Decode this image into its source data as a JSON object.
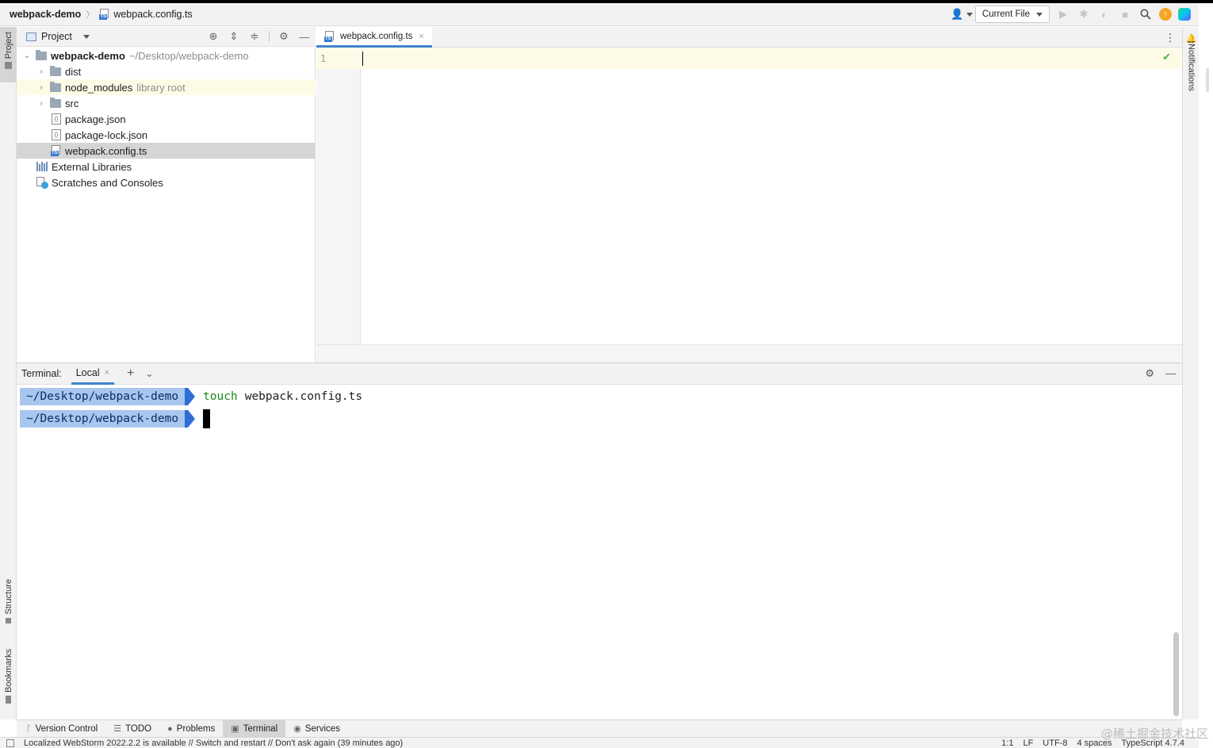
{
  "titlebar": {
    "project": "webpack-demo",
    "file": "webpack.config.ts",
    "run_config": "Current File"
  },
  "left_strip": {
    "project_tab": "Project",
    "structure_tab": "Structure",
    "bookmarks_tab": "Bookmarks"
  },
  "right_strip": {
    "notifications_tab": "Notifications"
  },
  "project_panel": {
    "title": "Project",
    "tree": [
      {
        "label": "webpack-demo",
        "hint": "~/Desktop/webpack-demo"
      },
      {
        "label": "dist",
        "hint": ""
      },
      {
        "label": "node_modules",
        "hint": "library root"
      },
      {
        "label": "src",
        "hint": ""
      },
      {
        "label": "package.json",
        "hint": ""
      },
      {
        "label": "package-lock.json",
        "hint": ""
      },
      {
        "label": "webpack.config.ts",
        "hint": ""
      },
      {
        "label": "External Libraries",
        "hint": ""
      },
      {
        "label": "Scratches and Consoles",
        "hint": ""
      }
    ]
  },
  "editor": {
    "tab_label": "webpack.config.ts",
    "line_number": "1"
  },
  "terminal": {
    "label": "Terminal:",
    "tab": "Local",
    "lines": [
      {
        "prompt": "~/Desktop/webpack-demo",
        "command": "touch",
        "args": "webpack.config.ts"
      },
      {
        "prompt": "~/Desktop/webpack-demo",
        "command": "",
        "args": ""
      }
    ]
  },
  "bottom_tabs": [
    "Version Control",
    "TODO",
    "Problems",
    "Terminal",
    "Services"
  ],
  "status": {
    "message": "Localized WebStorm 2022.2.2 is available // Switch and restart // Don't ask again (39 minutes ago)",
    "position": "1:1",
    "line_sep": "LF",
    "encoding": "UTF-8",
    "indent": "4 spaces",
    "language": "TypeScript 4.7.4"
  },
  "watermark": "@稀土掘金技术社区"
}
